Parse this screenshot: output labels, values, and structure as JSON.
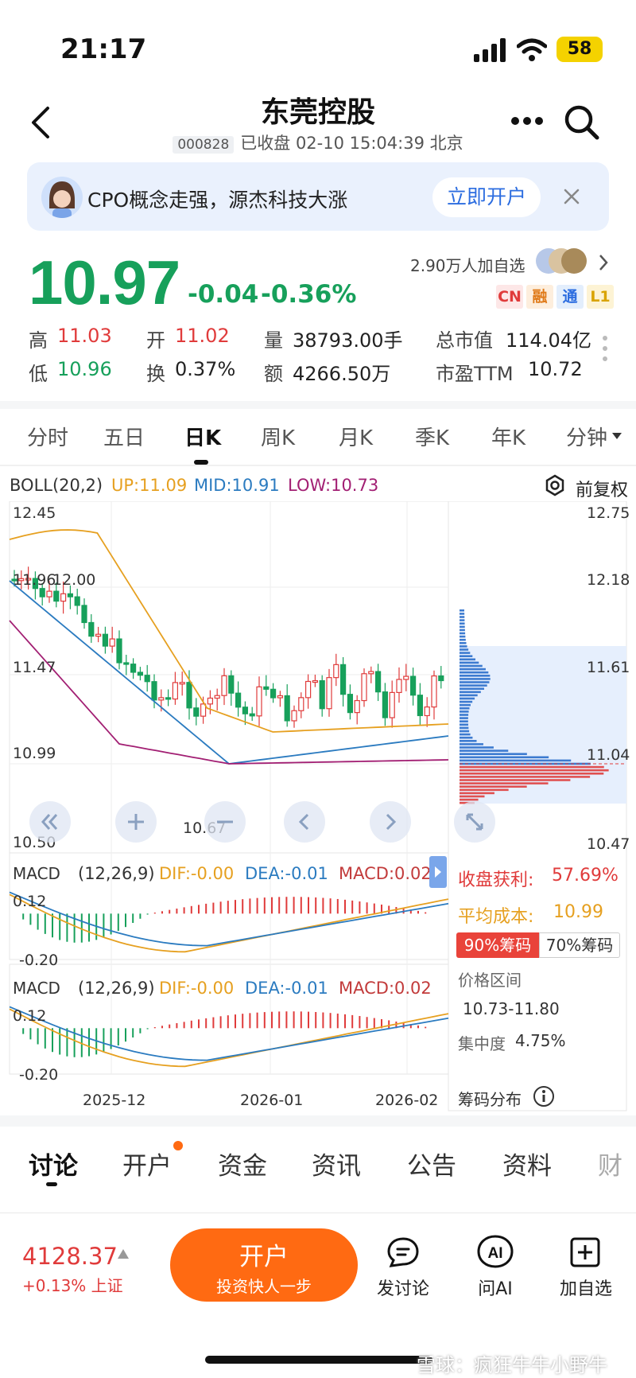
{
  "status_bar": {
    "time": "21:17",
    "battery": "58"
  },
  "header": {
    "title": "东莞控股",
    "code": "000828",
    "status": "已收盘 02-10 15:04:39 北京"
  },
  "banner": {
    "text": "CPO概念走强，源杰科技大涨",
    "button": "立即开户"
  },
  "quote": {
    "price": "10.97",
    "change": "-0.04",
    "change_pct": "-0.36%",
    "followers": "2.90万人加自选",
    "badges": [
      "CN",
      "融",
      "通",
      "L1"
    ],
    "stats": {
      "high_label": "高",
      "high": "11.03",
      "low_label": "低",
      "low": "10.96",
      "open_label": "开",
      "open": "11.02",
      "turnover_label": "换",
      "turnover": "0.37%",
      "volume_label": "量",
      "volume": "38793.00手",
      "amount_label": "额",
      "amount": "4266.50万",
      "mcap_label": "总市值",
      "mcap": "114.04亿",
      "pe_label": "市盈TTM",
      "pe": "10.72"
    }
  },
  "period_tabs": [
    "分时",
    "五日",
    "日K",
    "周K",
    "月K",
    "季K",
    "年K",
    "分钟"
  ],
  "active_tab": "日K",
  "boll": {
    "name": "BOLL(20,2)",
    "up": "UP:11.09",
    "mid": "MID:10.91",
    "low": "LOW:10.73",
    "adjust": "前复权"
  },
  "price_axis": {
    "left": [
      "12.45",
      "11.96",
      "12.00",
      "11.47",
      "10.99",
      "10.50"
    ],
    "right": [
      "12.75",
      "12.18",
      "11.61",
      "11.04",
      "10.47"
    ],
    "min_label": "10.67"
  },
  "macd": {
    "name": "MACD",
    "params": "(12,26,9)",
    "dif": "DIF:-0.00",
    "dea": "DEA:-0.01",
    "macd": "MACD:0.02",
    "top": "0.12",
    "bottom": "-0.20"
  },
  "dates": [
    "2025-12",
    "2026-01",
    "2026-02"
  ],
  "chips": {
    "profit_label": "收盘获利:",
    "profit": "57.69%",
    "cost_label": "平均成本:",
    "cost": "10.99",
    "tab90": "90%筹码",
    "tab70": "70%筹码",
    "range_label": "价格区间",
    "range": "10.73-11.80",
    "conc_label": "集中度",
    "conc": "4.75%",
    "dist_label": "筹码分布"
  },
  "bottom_tabs": [
    "讨论",
    "开户",
    "资金",
    "资讯",
    "公告",
    "资料",
    "财"
  ],
  "footer": {
    "index_value": "4128.37",
    "index_change": "+0.13%",
    "index_name": "上证",
    "open_main": "开户",
    "open_sub": "投资快人一步",
    "actions": [
      "发讨论",
      "问AI",
      "加自选"
    ],
    "watermark": "雪球：疯狂牛牛小野牛"
  },
  "colors": {
    "green": "#17a05b",
    "red": "#e03b3b",
    "orange": "#e6a020",
    "blue": "#2b7bc0",
    "purple": "#a21f73",
    "brand": "#ff6a12"
  }
}
